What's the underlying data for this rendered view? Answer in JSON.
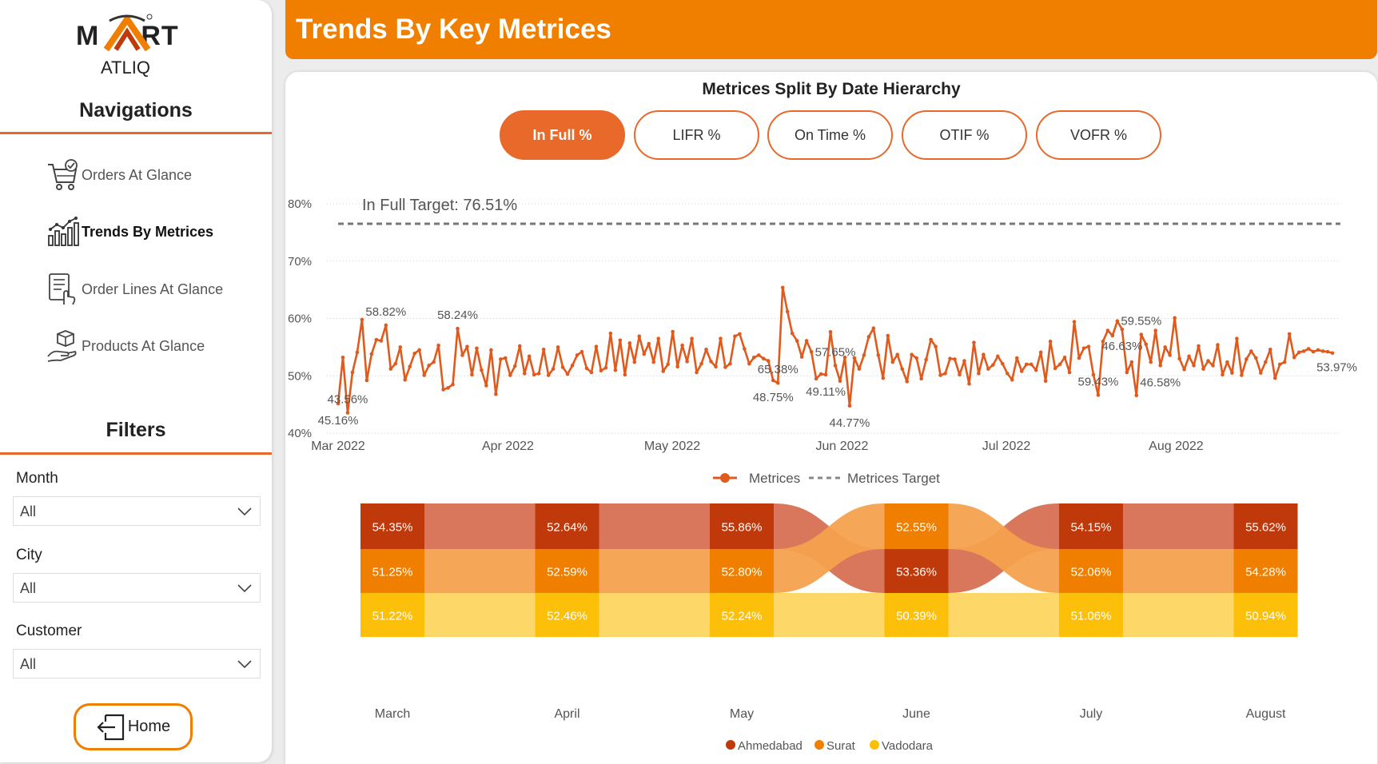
{
  "brand": {
    "logo_left": "M",
    "logo_right": "RT",
    "logo_sub": "ATLIQ"
  },
  "sidebar": {
    "nav_title": "Navigations",
    "nav_items": [
      {
        "label": "Orders At Glance",
        "icon": "cart-check-icon",
        "active": false
      },
      {
        "label": "Trends By Metrices",
        "icon": "chart-trend-icon",
        "active": true
      },
      {
        "label": "Order Lines At Glance",
        "icon": "checklist-hand-icon",
        "active": false
      },
      {
        "label": "Products At Glance",
        "icon": "box-hand-icon",
        "active": false
      }
    ],
    "filters_title": "Filters",
    "filters": [
      {
        "label": "Month",
        "value": "All"
      },
      {
        "label": "City",
        "value": "All"
      },
      {
        "label": "Customer",
        "value": "All"
      }
    ],
    "home_label": "Home"
  },
  "header": {
    "title": "Trends By Key Metrices"
  },
  "main": {
    "card_title": "Metrices Split By Date Hierarchy",
    "metric_tabs": [
      {
        "label": "In Full %",
        "active": true
      },
      {
        "label": "LIFR %",
        "active": false
      },
      {
        "label": "On Time %",
        "active": false
      },
      {
        "label": "OTIF %",
        "active": false
      },
      {
        "label": "VOFR %",
        "active": false
      }
    ]
  },
  "colors": {
    "accent": "#f07f00",
    "line": "#e05a1e",
    "ahmedabad": "#c0390b",
    "surat": "#f07f00",
    "vadodara": "#fcc00b"
  },
  "chart_data": [
    {
      "type": "line",
      "target_label": "In Full Target: 76.51%",
      "target": 76.51,
      "ylim": [
        40,
        80
      ],
      "yticks": [
        "40%",
        "50%",
        "60%",
        "70%",
        "80%"
      ],
      "x_start": "2022-03-01",
      "x_end": "2022-08-31",
      "xtick_labels": [
        {
          "date": "2022-03-01",
          "label": "Mar 2022"
        },
        {
          "date": "2022-04-01",
          "label": "Apr 2022"
        },
        {
          "date": "2022-05-01",
          "label": "May 2022"
        },
        {
          "date": "2022-06-01",
          "label": "Jun 2022"
        },
        {
          "date": "2022-07-01",
          "label": "Jul 2022"
        },
        {
          "date": "2022-08-01",
          "label": "Aug 2022"
        }
      ],
      "legend": [
        "Metrices",
        "Metrices Target"
      ],
      "grid": true,
      "values": [
        45.16,
        53.2,
        43.56,
        50.6,
        54.1,
        59.8,
        49.2,
        53.8,
        56.3,
        56.1,
        58.82,
        51.2,
        52.1,
        55.0,
        49.3,
        51.6,
        53.9,
        54.5,
        50.1,
        51.8,
        52.4,
        55.3,
        47.6,
        47.9,
        48.5,
        58.24,
        53.6,
        55.1,
        50.2,
        54.8,
        51.0,
        48.3,
        54.5,
        46.8,
        52.9,
        53.1,
        50.1,
        51.7,
        55.2,
        50.4,
        53.4,
        50.2,
        50.4,
        54.6,
        50.1,
        51.2,
        55.0,
        51.5,
        50.3,
        51.8,
        53.6,
        54.2,
        51.3,
        50.6,
        55.1,
        50.9,
        51.4,
        57.4,
        51.0,
        56.2,
        50.2,
        55.7,
        52.4,
        56.9,
        53.8,
        55.6,
        52.4,
        56.5,
        50.8,
        52.0,
        57.7,
        51.6,
        55.3,
        52.5,
        56.5,
        50.6,
        52.1,
        54.6,
        52.5,
        51.6,
        56.5,
        51.5,
        52.1,
        56.9,
        57.3,
        54.7,
        52.1,
        53.2,
        53.6,
        53.0,
        52.6,
        49.2,
        48.75,
        65.38,
        61.2,
        57.4,
        56.1,
        53.3,
        56.1,
        54.2,
        49.5,
        50.3,
        50.2,
        57.65,
        51.8,
        49.1,
        53.2,
        44.77,
        53.1,
        51.2,
        53.6,
        56.8,
        58.3,
        53.6,
        49.6,
        57.0,
        52.4,
        53.7,
        51.2,
        49.0,
        53.7,
        53.1,
        49.5,
        52.8,
        56.3,
        55.1,
        50.1,
        50.4,
        53.0,
        52.9,
        50.2,
        52.6,
        48.6,
        55.8,
        50.4,
        53.7,
        51.2,
        51.9,
        53.4,
        52.1,
        50.4,
        49.3,
        53.1,
        50.8,
        52.0,
        52.0,
        51.0,
        54.1,
        49.1,
        56.0,
        51.3,
        52.0,
        53.2,
        50.6,
        59.43,
        53.1,
        54.8,
        55.1,
        50.2,
        46.63,
        56.0,
        57.9,
        57.0,
        59.55,
        58.1,
        50.6,
        52.4,
        46.58,
        57.2,
        55.5,
        52.4,
        57.9,
        51.8,
        55.0,
        53.6,
        60.1,
        53.0,
        51.1,
        53.4,
        51.8,
        55.2,
        51.2,
        52.6,
        51.8,
        55.4,
        50.2,
        52.4,
        50.5,
        56.5,
        50.1,
        52.9,
        54.3,
        53.1,
        50.5,
        52.4,
        54.6,
        49.6,
        52.0,
        52.4,
        57.3,
        53.2,
        54.1,
        54.3,
        54.7,
        54.2,
        54.5,
        54.3,
        54.2,
        53.97
      ],
      "point_labels": [
        {
          "i": 0,
          "text": "45.16%",
          "pos": "below"
        },
        {
          "i": 2,
          "text": "43.56%",
          "pos": "above"
        },
        {
          "i": 10,
          "text": "58.82%",
          "pos": "above"
        },
        {
          "i": 25,
          "text": "58.24%",
          "pos": "above"
        },
        {
          "i": 91,
          "text": "48.75%",
          "pos": "below"
        },
        {
          "i": 92,
          "text": "65.38%",
          "pos": "above"
        },
        {
          "i": 102,
          "text": "49.11%",
          "pos": "below"
        },
        {
          "i": 104,
          "text": "57.65%",
          "pos": "above"
        },
        {
          "i": 107,
          "text": "44.77%",
          "pos": "below"
        },
        {
          "i": 159,
          "text": "59.43%",
          "pos": "above"
        },
        {
          "i": 164,
          "text": "46.63%",
          "pos": "below"
        },
        {
          "i": 168,
          "text": "59.55%",
          "pos": "above"
        },
        {
          "i": 172,
          "text": "46.58%",
          "pos": "below"
        },
        {
          "i": 203,
          "text": "53.97%",
          "pos": "right"
        }
      ]
    },
    {
      "type": "ribbon",
      "categories": [
        "March",
        "April",
        "May",
        "June",
        "July",
        "August"
      ],
      "series": [
        {
          "name": "Ahmedabad",
          "values": [
            54.35,
            52.64,
            55.86,
            52.55,
            54.15,
            55.62
          ]
        },
        {
          "name": "Surat",
          "values": [
            51.25,
            52.59,
            52.8,
            53.36,
            52.06,
            54.28
          ]
        },
        {
          "name": "Vadodara",
          "values": [
            51.22,
            52.46,
            52.24,
            50.39,
            51.06,
            50.94
          ]
        }
      ],
      "labels": [
        [
          "54.35%",
          "51.25%",
          "51.22%"
        ],
        [
          "52.64%",
          "52.59%",
          "52.46%"
        ],
        [
          "55.86%",
          "52.80%",
          "52.24%"
        ],
        [
          "53.36%",
          "52.55%",
          "50.39%"
        ],
        [
          "54.15%",
          "52.06%",
          "51.06%"
        ],
        [
          "55.62%",
          "54.28%",
          "50.94%"
        ]
      ],
      "legend": [
        "Ahmedabad",
        "Surat",
        "Vadodara"
      ]
    }
  ]
}
